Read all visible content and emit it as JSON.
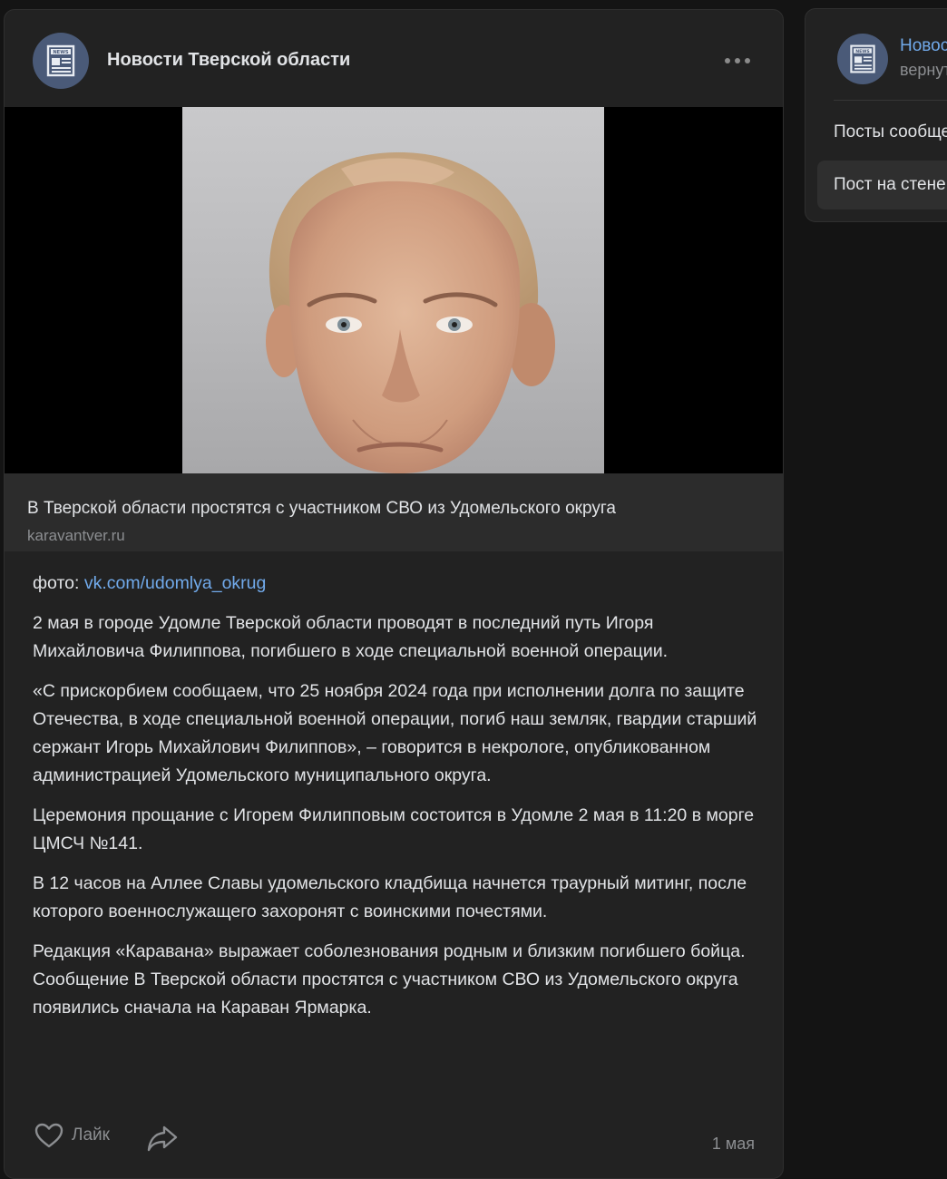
{
  "post": {
    "group_name": "Новости Тверской области",
    "avatar_label": "NEWS",
    "link_card": {
      "title": "В Тверской области простятся с участником СВО из Удомельского округа",
      "domain": "karavantver.ru"
    },
    "photo_prefix": "фото: ",
    "photo_link": "vk.com/udomlya_okrug",
    "paragraphs": [
      "2 мая в городе Удомле Тверской области проводят в последний путь Игоря Михайловича Филиппова, погибшего в ходе специальной военной операции.",
      "«С прискорбием сообщаем, что 25 ноября 2024 года при исполнении долга по защите Отечества, в ходе специальной военной операции, погиб наш земляк, гвардии старший сержант Игорь Михайлович Филиппов», – говорится в некрологе, опубликованном администрацией Удомельского муниципального округа.",
      "Церемония прощание с Игорем Филипповым состоится в Удомле 2 мая в 11:20 в морге ЦМСЧ №141.",
      "В 12 часов на Аллее Славы удомельского кладбища начнется траурный митинг, после которого военнослужащего захоронят с воинскими почестями.",
      "Редакция «Каравана» выражает соболезнования родным и близким погибшего бойца.",
      "Сообщение В Тверской области простятся с участником СВО из Удомельского округа появились сначала на Караван Ярмарка."
    ],
    "like_label": "Лайк",
    "date": "1 мая"
  },
  "sidebar": {
    "group_name": "Новости Тверской области",
    "subtitle": "вернуться к сообществу",
    "items": [
      {
        "label": "Посты сообщества"
      },
      {
        "label": "Пост на стене"
      }
    ]
  },
  "colors": {
    "background": "#141414",
    "card": "#222222",
    "accent_link": "#71aaeb",
    "muted_text": "#8c8e91"
  },
  "icons": [
    "news-icon",
    "more-icon",
    "heart-icon",
    "share-icon"
  ]
}
